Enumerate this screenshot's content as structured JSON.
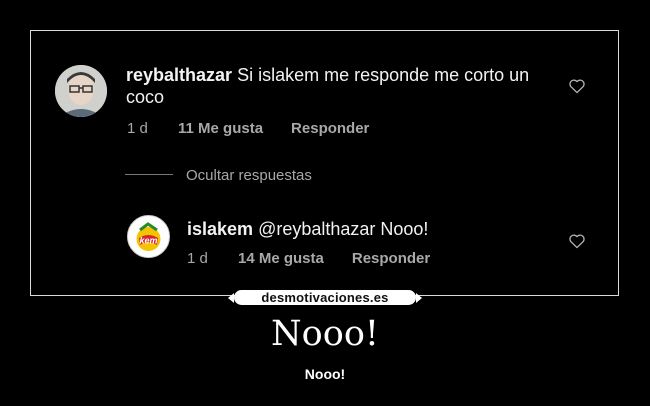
{
  "comment": {
    "username": "reybalthazar",
    "text": "Si islakem me responde me corto un coco",
    "time": "1 d",
    "likes": "11 Me gusta",
    "reply_label": "Responder"
  },
  "hide_replies_label": "Ocultar respuestas",
  "reply": {
    "username": "islakem",
    "text": "@reybalthazar Nooo!",
    "time": "1 d",
    "likes": "14 Me gusta",
    "reply_label": "Responder",
    "logo_text": "kem"
  },
  "watermark": "desmotivaciones.es",
  "caption": "Nooo!",
  "subcaption": "Nooo!",
  "colors": {
    "background": "#000000",
    "text": "#f2f2f2",
    "muted": "#a8a8a8",
    "logo_yellow": "#f5c400",
    "logo_red": "#d7262b"
  }
}
